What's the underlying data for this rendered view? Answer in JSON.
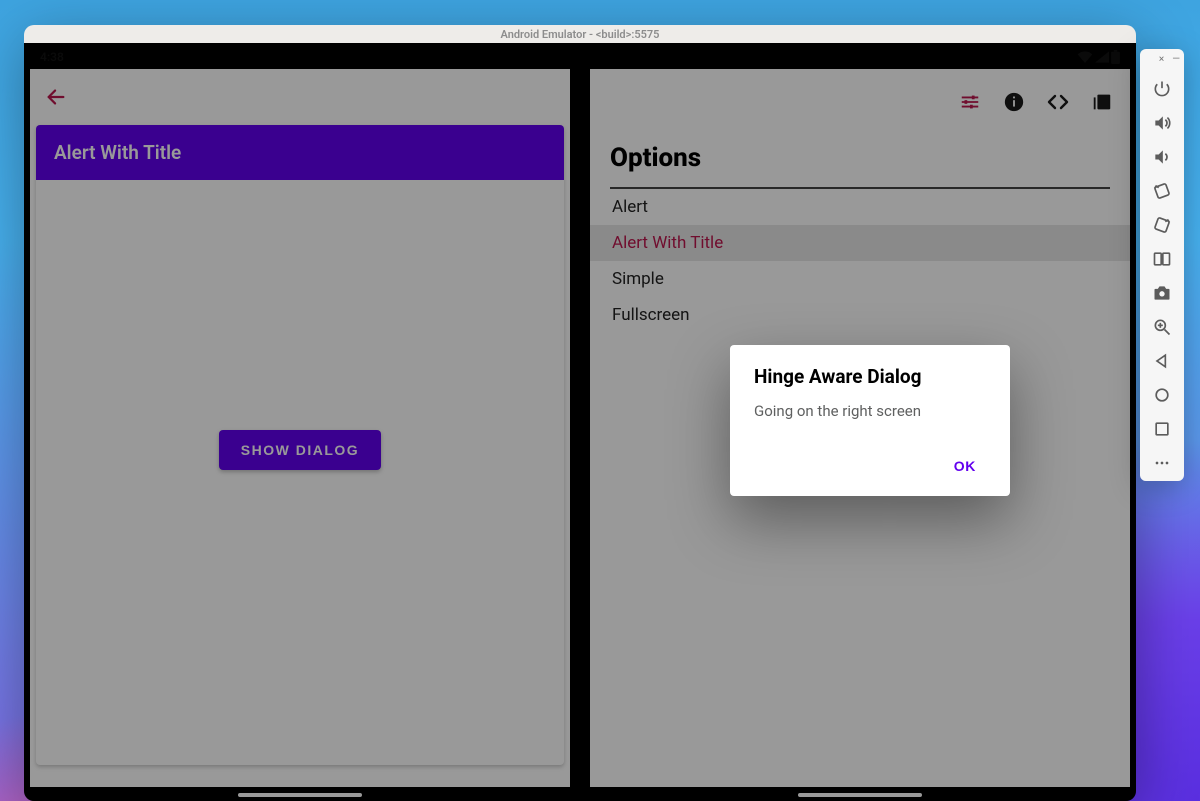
{
  "emulator": {
    "title": "Android Emulator - <build>:5575"
  },
  "status": {
    "time": "4:38"
  },
  "left": {
    "header": "Alert With Title",
    "button": "SHOW DIALOG"
  },
  "right": {
    "title": "Options",
    "items": [
      {
        "label": "Alert",
        "selected": false
      },
      {
        "label": "Alert With Title",
        "selected": true
      },
      {
        "label": "Simple",
        "selected": false
      },
      {
        "label": "Fullscreen",
        "selected": false
      }
    ]
  },
  "dialog": {
    "title": "Hinge Aware Dialog",
    "body": "Going on the right screen",
    "ok": "OK"
  },
  "icons": {
    "right_top": [
      "tune-icon",
      "info-icon",
      "code-icon",
      "library-icon"
    ],
    "side": [
      "power-icon",
      "volume-up-icon",
      "volume-down-icon",
      "rotate-left-icon",
      "rotate-right-icon",
      "fold-icon",
      "camera-icon",
      "zoom-icon",
      "back-triangle-icon",
      "home-circle-icon",
      "overview-square-icon",
      "more-icon"
    ]
  }
}
